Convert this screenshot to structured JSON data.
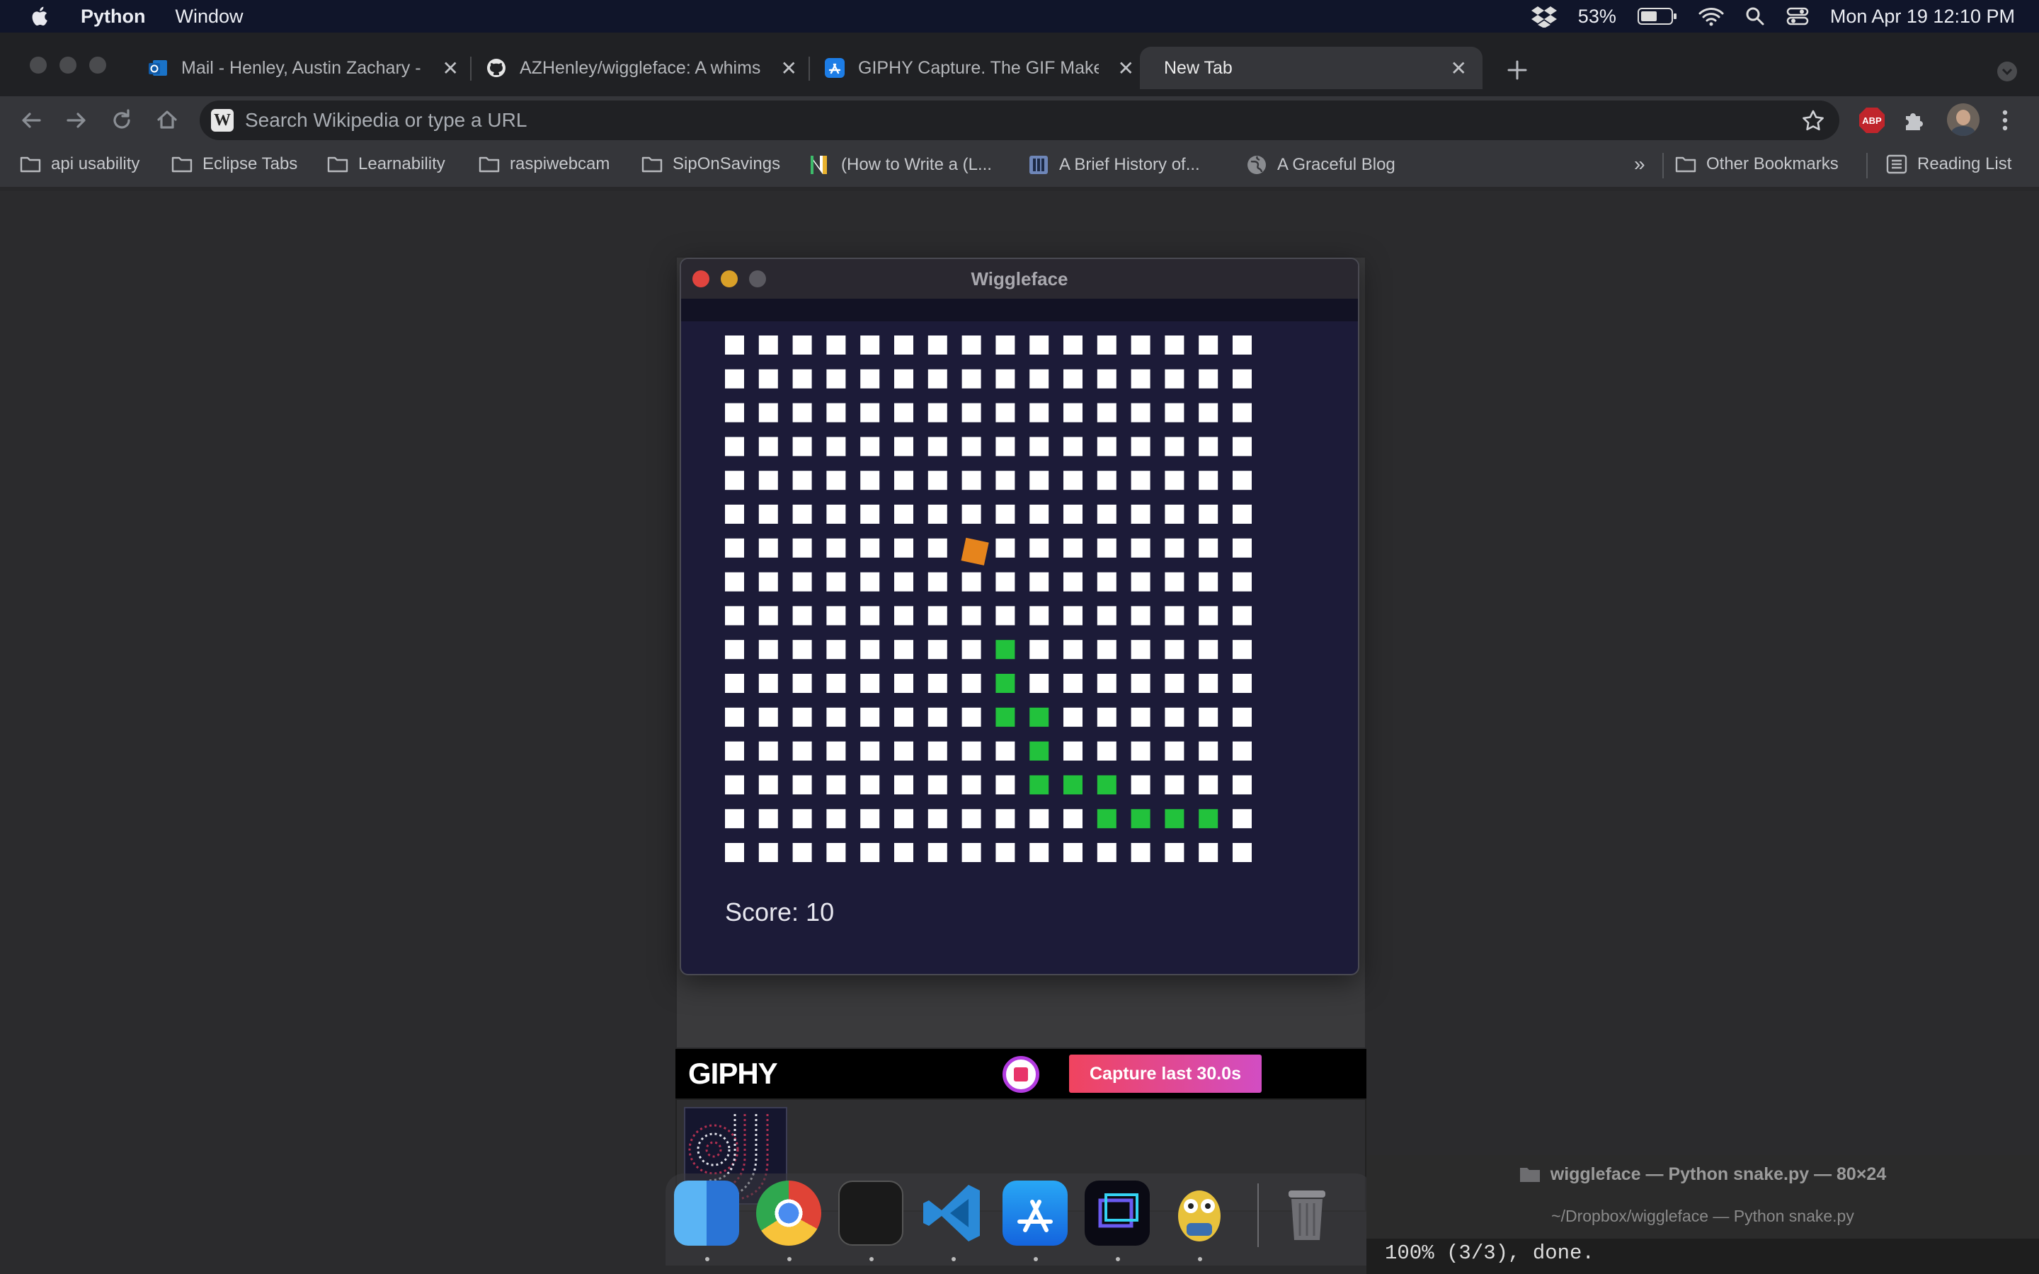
{
  "menubar": {
    "app_name": "Python",
    "menu_window": "Window",
    "battery_percent": "53%",
    "datetime": "Mon Apr 19  12:10 PM"
  },
  "browser": {
    "tabs": [
      {
        "label": "Mail - Henley, Austin Zachary -",
        "icon": "outlook-icon"
      },
      {
        "label": "AZHenley/wiggleface: A whims",
        "icon": "github-icon"
      },
      {
        "label": "GIPHY Capture. The GIF Maker",
        "icon": "app-store-icon"
      },
      {
        "label": "New Tab",
        "icon": ""
      }
    ],
    "omnibox_placeholder": "Search Wikipedia or type a URL",
    "bookmarks": [
      "api usability",
      "Eclipse Tabs",
      "Learnability",
      "raspiwebcam",
      "SipOnSavings",
      "(How to Write a (L...",
      "A Brief History of...",
      "A Graceful Blog"
    ],
    "other_bookmarks": "Other Bookmarks",
    "reading_list": "Reading List",
    "overflow": "»"
  },
  "wiggleface": {
    "title": "Wiggleface",
    "score_text": "Score: 10",
    "grid_cols": 16,
    "grid_rows": 16,
    "food": {
      "col": 7,
      "row": 6
    },
    "snake": [
      [
        8,
        9
      ],
      [
        8,
        10
      ],
      [
        8,
        11
      ],
      [
        9,
        11
      ],
      [
        9,
        12
      ],
      [
        9,
        13
      ],
      [
        10,
        13
      ],
      [
        11,
        13
      ],
      [
        11,
        14
      ],
      [
        12,
        14
      ],
      [
        13,
        14
      ],
      [
        14,
        14
      ]
    ],
    "colors": {
      "background": "#1c1b38",
      "cell": "#ffffff",
      "snake": "#22c23c",
      "food": "#e6841c"
    }
  },
  "giphy": {
    "logo": "GIPHY",
    "capture_label": "Capture last 30.0s"
  },
  "terminal": {
    "title": "wiggleface — Python snake.py — 80×24",
    "subtitle": "~/Dropbox/wiggleface — Python snake.py",
    "line": "100% (3/3), done."
  },
  "dock": {
    "apps": [
      "finder-icon",
      "chrome-icon",
      "terminal-icon",
      "vscode-icon",
      "app-store-icon",
      "giphy-capture-icon",
      "python-icon",
      "trash-icon"
    ]
  }
}
